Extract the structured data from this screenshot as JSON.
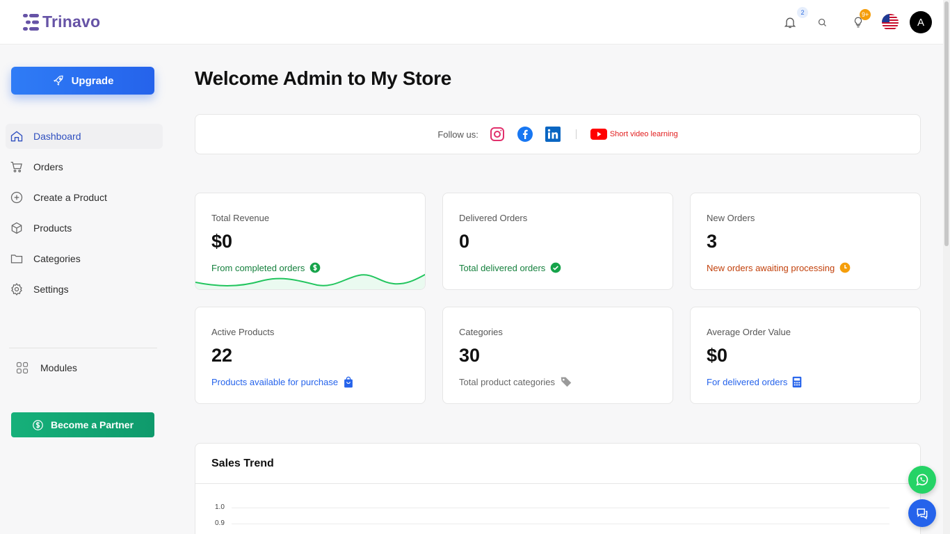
{
  "brand": {
    "name": "Trinavo",
    "color": "#6653a6"
  },
  "header": {
    "notifications_badge": "2",
    "ideas_badge": "9+",
    "avatar_initial": "A",
    "icons": [
      "bell-icon",
      "search-icon",
      "lightbulb-icon",
      "us-flag-icon"
    ]
  },
  "sidebar": {
    "upgrade_label": "Upgrade",
    "items": [
      {
        "label": "Dashboard",
        "icon": "home-icon",
        "active": true
      },
      {
        "label": "Orders",
        "icon": "cart-icon"
      },
      {
        "label": "Create a Product",
        "icon": "plus-circle-icon"
      },
      {
        "label": "Products",
        "icon": "box-icon"
      },
      {
        "label": "Categories",
        "icon": "folder-icon"
      },
      {
        "label": "Settings",
        "icon": "gear-icon"
      }
    ],
    "modules_label": "Modules",
    "partner_label": "Become a Partner"
  },
  "main": {
    "title": "Welcome Admin to My Store",
    "follow": {
      "label": "Follow us:",
      "video_link": "Short video learning"
    },
    "stats": [
      {
        "title": "Total Revenue",
        "value": "$0",
        "sub": "From completed orders",
        "tone": "green"
      },
      {
        "title": "Delivered Orders",
        "value": "0",
        "sub": "Total delivered orders",
        "tone": "green"
      },
      {
        "title": "New Orders",
        "value": "3",
        "sub": "New orders awaiting processing",
        "tone": "orange"
      },
      {
        "title": "Active Products",
        "value": "22",
        "sub": "Products available for purchase",
        "tone": "blue"
      },
      {
        "title": "Categories",
        "value": "30",
        "sub": "Total product categories",
        "tone": "grey"
      },
      {
        "title": "Average Order Value",
        "value": "$0",
        "sub": "For delivered orders",
        "tone": "blue"
      }
    ],
    "sales_trend": {
      "title": "Sales Trend",
      "y_ticks": [
        "1.0",
        "0.9"
      ]
    }
  },
  "colors": {
    "accent_blue": "#2563eb",
    "partner_green": "#16b07a",
    "whatsapp_green": "#25d366"
  }
}
